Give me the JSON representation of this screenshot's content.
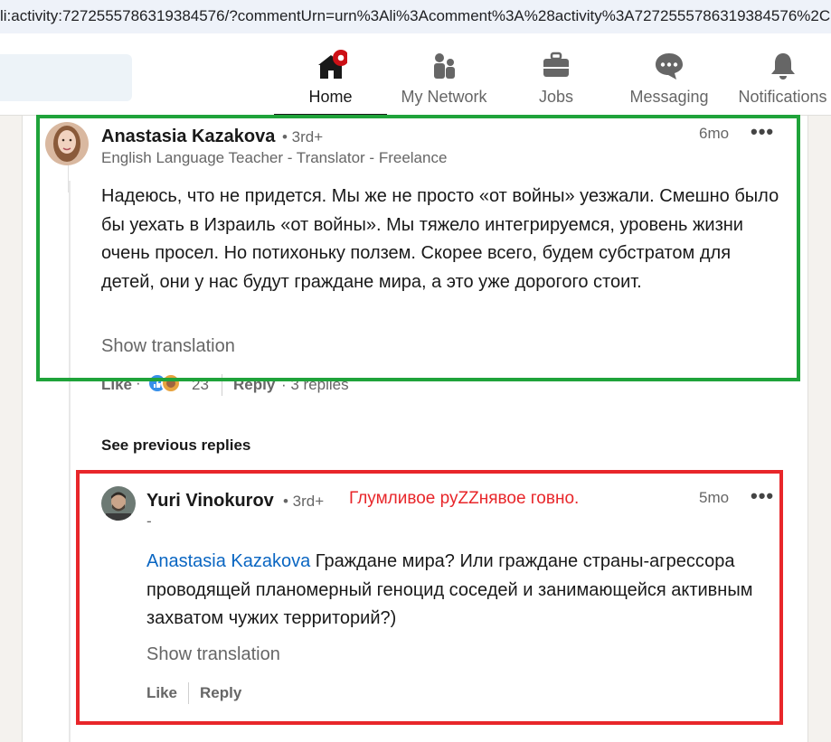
{
  "browser": {
    "url": "li:activity:7272555786319384576/?commentUrn=urn%3Ali%3Acomment%3A%28activity%3A7272555786319384576%2C"
  },
  "nav": {
    "items": [
      {
        "label": "Home",
        "icon": "home-icon",
        "active": true,
        "badge": true
      },
      {
        "label": "My Network",
        "icon": "people-icon"
      },
      {
        "label": "Jobs",
        "icon": "briefcase-icon"
      },
      {
        "label": "Messaging",
        "icon": "chat-icon"
      },
      {
        "label": "Notifications",
        "icon": "bell-icon"
      }
    ]
  },
  "comment": {
    "author": "Anastasia Kazakova",
    "degree": "• 3rd+",
    "headline": "English Language Teacher - Translator - Freelance",
    "time": "6mo",
    "more": "•••",
    "text": "Надеюсь, что не придется. Мы же не просто «от войны» уезжали. Смешно было бы уехать в Израиль «от войны». Мы тяжело интегрируемся, уровень жизни очень просел. Но потихоньку ползем. Скорее всего, будем субстратом для детей, они у нас будут граждане мира, а это уже дорогого стоит.",
    "show_translation": "Show translation",
    "like": "Like",
    "dot": "·",
    "reaction_count": "23",
    "reply": "Reply",
    "replies": "· 3 replies"
  },
  "see_previous": "See previous replies",
  "reply": {
    "author": "Yuri Vinokurov",
    "degree": "• 3rd+",
    "headline": "-",
    "time": "5mo",
    "more": "•••",
    "mention": "Anastasia Kazakova",
    "text": " Граждане мира? Или граждане страны-агрессора проводящей планомерный геноцид соседей и занимающейся активным захватом чужих территорий?)",
    "show_translation": "Show translation",
    "like": "Like",
    "reply": "Reply"
  },
  "annotation": {
    "text": "Глумливое руZZнявое говно.",
    "color": "#e8262a"
  },
  "colors": {
    "green_box": "#1fa33a",
    "red_box": "#e8262a",
    "link": "#0a66c2",
    "badge": "#cc1016"
  }
}
